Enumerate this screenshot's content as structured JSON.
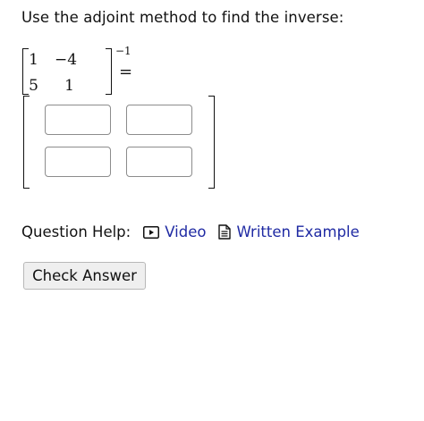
{
  "question": {
    "prompt": "Use the adjoint method to find the inverse:",
    "matrix": {
      "rows": [
        [
          "1",
          "−4"
        ],
        [
          "5",
          "1"
        ]
      ],
      "exponent": "−1",
      "equals": "="
    }
  },
  "answer": {
    "cells": [
      {
        "value": "",
        "placeholder": ""
      },
      {
        "value": "",
        "placeholder": ""
      },
      {
        "value": "",
        "placeholder": ""
      },
      {
        "value": "",
        "placeholder": ""
      }
    ]
  },
  "help": {
    "label": "Question Help:",
    "video_label": "Video",
    "video_icon": "play-video-icon",
    "example_label": "Written Example",
    "example_icon": "document-icon",
    "link_color": "#1f2aa3"
  },
  "actions": {
    "check_label": "Check Answer"
  }
}
